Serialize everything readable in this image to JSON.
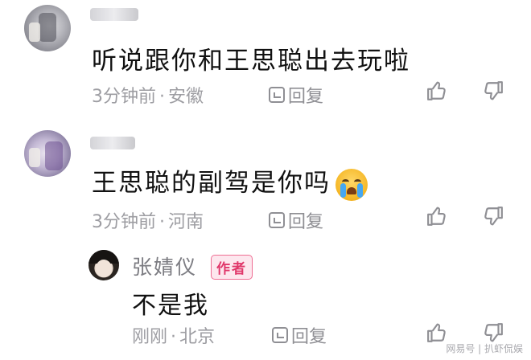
{
  "comments": [
    {
      "text": "听说跟你和王思聪出去玩啦",
      "time": "3分钟前",
      "separator": "·",
      "location": "安徽",
      "reply_label": "回复"
    },
    {
      "text": "王思聪的副驾是你吗",
      "emoji": "loudly-crying-face",
      "time": "3分钟前",
      "separator": "·",
      "location": "河南",
      "reply_label": "回复"
    }
  ],
  "author_reply": {
    "username": "张婧仪",
    "badge": "作者",
    "text": "不是我",
    "time": "刚刚",
    "separator": "·",
    "location": "北京",
    "reply_label": "回复"
  },
  "watermark": "网易号 | 扒虾侃娱",
  "colors": {
    "badge_text": "#e0376a",
    "badge_bg": "#fde7ee",
    "meta_text": "#9d9da2"
  }
}
